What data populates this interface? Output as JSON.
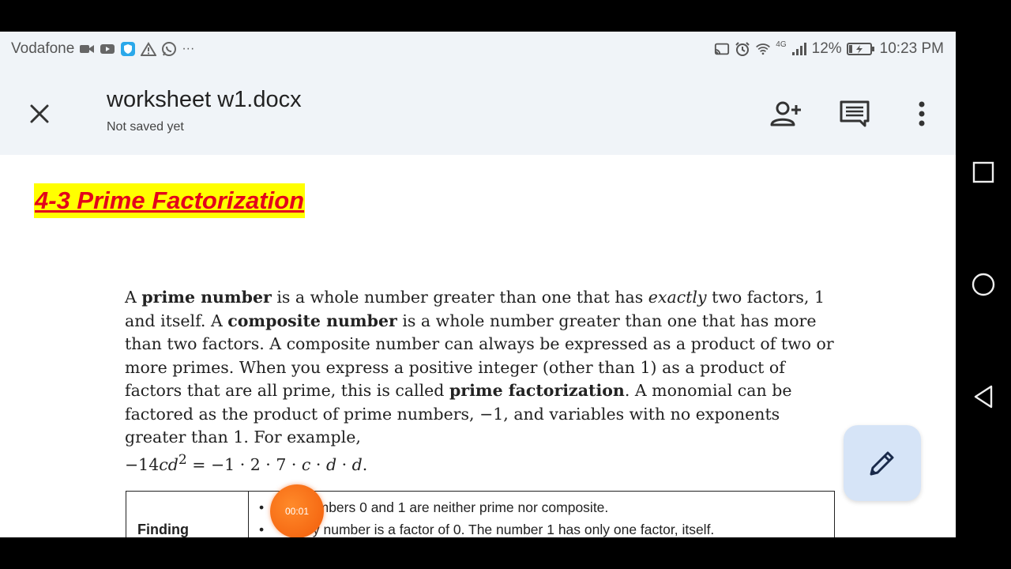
{
  "status_bar": {
    "carrier": "Vodafone",
    "dots": "···",
    "network_type": "4G",
    "battery": "12%",
    "time": "10:23 PM"
  },
  "app_bar": {
    "title": "worksheet w1.docx",
    "subtitle": "Not saved yet"
  },
  "document": {
    "heading": "4-3 Prime Factorization",
    "paragraph": {
      "s1": "A ",
      "s2": "prime number",
      "s3": " is a whole number greater than one that has ",
      "s4": "exactly",
      "s5": " two factors, 1 and itself. A ",
      "s6": "composite number",
      "s7": " is a whole number greater than one that has more than two factors. A composite number can always be expressed as a product of two or more primes. When you express a positive integer (other than 1) as a product of factors that are all prime, this is called ",
      "s8": "prime factorization",
      "s9": ". A monomial can be factored as the product of prime numbers, −1, and variables with no exponents greater than 1. For example, ",
      "eq_lhs": "−14",
      "eq_var": "cd",
      "eq_exp": "2",
      "eq_rhs1": " = −1 · 2 · 7 · ",
      "eq_c": "c",
      "eq_dot1": " · ",
      "eq_d1": "d",
      "eq_dot2": " · ",
      "eq_d2": "d",
      "eq_end": "."
    },
    "table": {
      "col1_label": "Finding",
      "bullet": "•",
      "row1": "umbers 0 and 1 are neither prime nor composite.",
      "row2": "Every number is a factor of 0. The number 1 has only one factor, itself."
    }
  },
  "timer_badge": "00:01",
  "colors": {
    "heading_text": "#e3001b",
    "heading_highlight": "#ffff00",
    "app_bar_bg": "#f0f4f8",
    "fab_bg": "#d6e4f7",
    "timer": "#f25c0a"
  }
}
